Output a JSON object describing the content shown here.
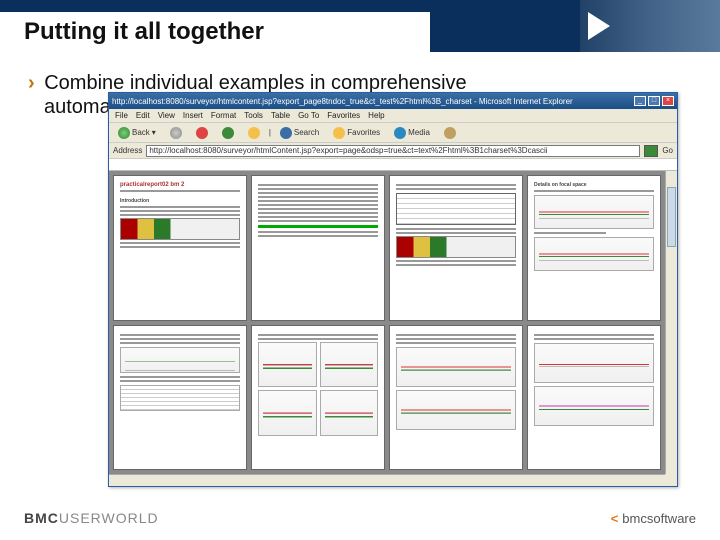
{
  "slide": {
    "title": "Putting it all together",
    "bullet_line1": "Combine individual examples in comprehensive",
    "bullet_line2": "automa"
  },
  "ie": {
    "titlebar": "http://localhost:8080/surveyor/htmlcontent.jsp?export_page8tndoc_true&ct_test%2Fhtml%3B_charset - Microsoft Internet Explorer",
    "menu": [
      "File",
      "Edit",
      "View",
      "Insert",
      "Format",
      "Tools",
      "Table",
      "Go To",
      "Favorites",
      "Help"
    ],
    "toolbar": {
      "back": "Back",
      "search": "Search",
      "favorites": "Favorites",
      "media": "Media"
    },
    "address_label": "Address",
    "address_value": "http://localhost:8080/surveyor/htmlContent.jsp?export=page&odsp=true&ct=text%2Fhtml%3B1charset%3Dcascii",
    "go": "Go"
  },
  "pages": {
    "p1_title": "practicalreport02 bm 2",
    "p1_section": "Introduction",
    "p2_title": "",
    "p4_title": "Details on focal space"
  },
  "footer": {
    "left_bold": "BMC",
    "left_rest": "USERWORLD",
    "right": "bmcsoftware"
  }
}
